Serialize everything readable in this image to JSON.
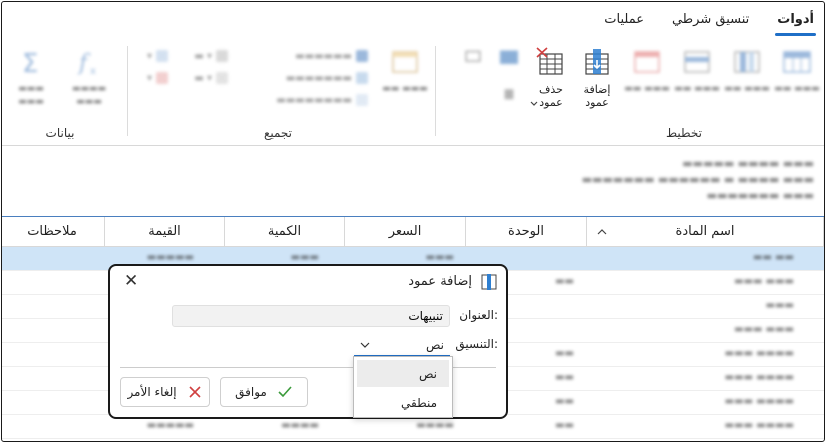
{
  "tabs": [
    {
      "label": "أدوات",
      "active": true
    },
    {
      "label": "تنسيق شرطي",
      "active": false
    },
    {
      "label": "عمليات",
      "active": false
    }
  ],
  "ribbon": {
    "layout_group": {
      "label": "تخطيط",
      "add_column": "إضافة\nعمود",
      "delete_column": "حذف\nعمود"
    },
    "group_group": {
      "label": "تجميع"
    },
    "data_group": {
      "label": "بيانات"
    }
  },
  "columns": [
    "اسم المادة",
    "الوحدة",
    "السعر",
    "الكمية",
    "القيمة",
    "ملاحظات"
  ],
  "dialog": {
    "title": "إضافة عمود",
    "title_label": "العنوان:",
    "title_value": "تنبيهات",
    "format_label": "التنسيق:",
    "format_value": "نص",
    "ok_label": "موافق",
    "cancel_label": "إلغاء الأمر"
  },
  "dropdown_options": [
    "نص",
    "منطقي"
  ],
  "colors": {
    "accent": "#1f6fc7",
    "selected_row": "#cfe4f7",
    "ok_green": "#3a9a3a",
    "cancel_red": "#d04040"
  }
}
